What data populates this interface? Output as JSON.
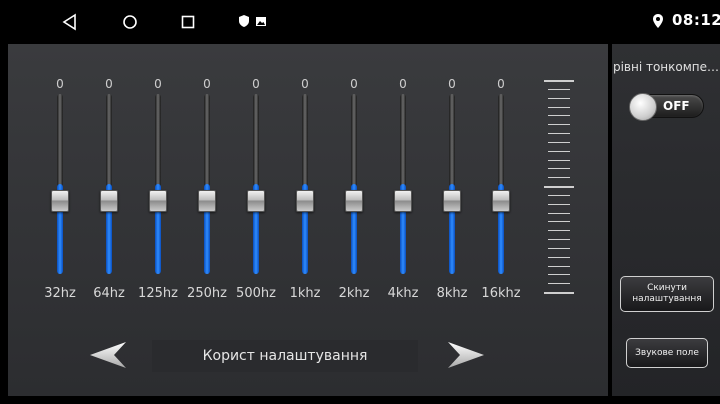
{
  "statusbar": {
    "icons": [
      "back-triangle-icon",
      "home-circle-icon",
      "recents-square-icon",
      "shield-icon",
      "image-icon",
      "location-pin-icon"
    ],
    "time": "08:12"
  },
  "equalizer": {
    "bands": [
      {
        "label": "32hz",
        "value": "0",
        "level": 0.5
      },
      {
        "label": "64hz",
        "value": "0",
        "level": 0.5
      },
      {
        "label": "125hz",
        "value": "0",
        "level": 0.5
      },
      {
        "label": "250hz",
        "value": "0",
        "level": 0.5
      },
      {
        "label": "500hz",
        "value": "0",
        "level": 0.5
      },
      {
        "label": "1khz",
        "value": "0",
        "level": 0.5
      },
      {
        "label": "2khz",
        "value": "0",
        "level": 0.5
      },
      {
        "label": "4khz",
        "value": "0",
        "level": 0.5
      },
      {
        "label": "8khz",
        "value": "0",
        "level": 0.5
      },
      {
        "label": "16khz",
        "value": "0",
        "level": 0.5
      }
    ],
    "preset_label": "Корист налаштування",
    "accent_color": "#2f8cff"
  },
  "side": {
    "title": "рівні тонкомпе…",
    "toggle_label": "OFF",
    "reset_button": "Скинути налаштування",
    "sound_field_button": "Звукове поле"
  }
}
